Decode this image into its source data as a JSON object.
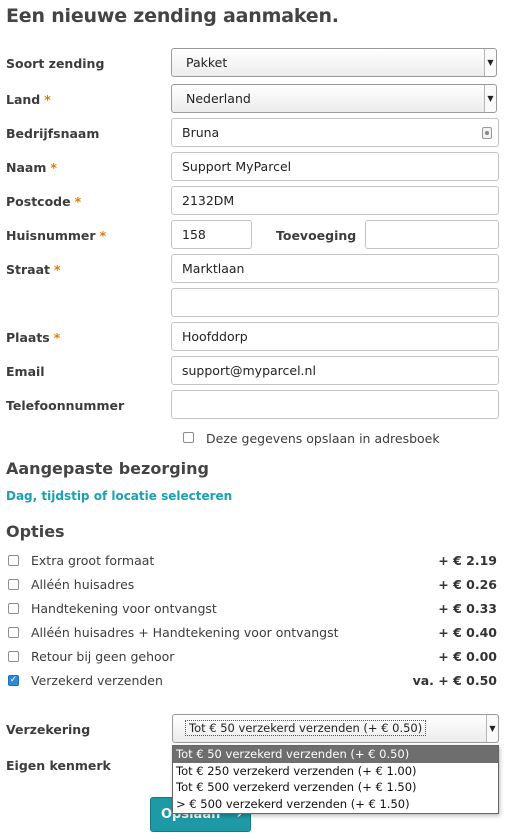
{
  "page": {
    "title": "Een nieuwe zending aanmaken."
  },
  "form": {
    "shipment_type": {
      "label": "Soort zending",
      "value": "Pakket"
    },
    "country": {
      "label": "Land",
      "required_mark": "*",
      "value": "Nederland"
    },
    "company": {
      "label": "Bedrijfsnaam",
      "value": "Bruna"
    },
    "name": {
      "label": "Naam",
      "required_mark": "*",
      "value": "Support MyParcel"
    },
    "postcode": {
      "label": "Postcode",
      "required_mark": "*",
      "value": "2132DM"
    },
    "house_number": {
      "label": "Huisnummer",
      "required_mark": "*",
      "value": "158"
    },
    "addition": {
      "label": "Toevoeging",
      "value": ""
    },
    "street": {
      "label": "Straat",
      "required_mark": "*",
      "value": "Marktlaan",
      "value2": ""
    },
    "city": {
      "label": "Plaats",
      "required_mark": "*",
      "value": "Hoofddorp"
    },
    "email": {
      "label": "Email",
      "value": "support@myparcel.nl"
    },
    "phone": {
      "label": "Telefoonnummer",
      "value": ""
    },
    "save_address": {
      "label": "Deze gegevens opslaan in adresboek",
      "checked": false
    }
  },
  "delivery": {
    "heading": "Aangepaste bezorging",
    "link": "Dag, tijdstip of locatie selecteren"
  },
  "options": {
    "heading": "Opties",
    "items": [
      {
        "label": "Extra groot formaat",
        "price": "+ € 2.19",
        "checked": false
      },
      {
        "label": "Alléén huisadres",
        "price": "+ € 0.26",
        "checked": false
      },
      {
        "label": "Handtekening voor ontvangst",
        "price": "+ € 0.33",
        "checked": false
      },
      {
        "label": "Alléén huisadres + Handtekening voor ontvangst",
        "price": "+ € 0.40",
        "checked": false
      },
      {
        "label": "Retour bij geen gehoor",
        "price": "+ € 0.00",
        "checked": false
      },
      {
        "label": "Verzekerd verzenden",
        "price": "va. + € 0.50",
        "checked": true
      }
    ]
  },
  "insurance": {
    "label": "Verzekering",
    "value": "Tot € 50 verzekerd verzenden (+ € 0.50)",
    "options": [
      "Tot € 50 verzekerd verzenden (+ € 0.50)",
      "Tot € 250 verzekerd verzenden (+ € 1.00)",
      "Tot € 500 verzekerd verzenden (+ € 1.50)",
      "> € 500 verzekerd verzenden (+ € 1.50)"
    ]
  },
  "reference": {
    "label": "Eigen kenmerk"
  },
  "actions": {
    "save_label": "Opslaan",
    "save_chevron": "›"
  },
  "colors": {
    "accent": "#1aa1b4",
    "button": "#1e9aa6",
    "required": "#e07b00",
    "checkbox_checked": "#2f88d8"
  },
  "icons": {
    "select_arrow": "chevron-down-icon",
    "contact": "contact-card-icon",
    "check": "checkmark-icon"
  }
}
